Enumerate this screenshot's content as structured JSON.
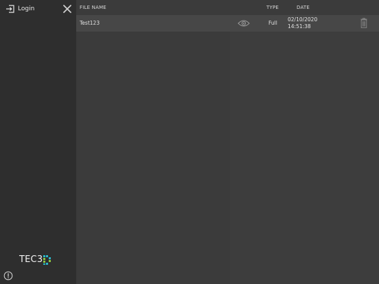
{
  "sidebar": {
    "login_label": "Login",
    "logo_text": "TEC3",
    "icons": {
      "login": "login-icon",
      "close": "close-icon",
      "info": "info-icon",
      "logo_mark": "logo-mark-icon"
    }
  },
  "table": {
    "headers": {
      "file_name": "FILE NAME",
      "type": "TYPE",
      "date": "DATE"
    },
    "rows": [
      {
        "name": "Test123",
        "type": "Full",
        "date": "02/10/2020",
        "time": "14:51:38"
      }
    ],
    "row_icons": [
      "eye-icon",
      "trash-icon"
    ]
  },
  "colors": {
    "sidebar_bg": "#2e2e2e",
    "main_bg": "#3b3b3b",
    "row_bg": "#474747",
    "logo_cyan": "#2ab7c9",
    "logo_green": "#8dc63f"
  }
}
